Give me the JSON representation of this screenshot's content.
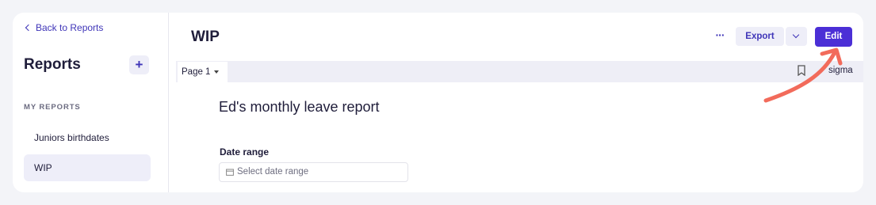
{
  "sidebar": {
    "back_link": "Back to Reports",
    "title": "Reports",
    "add_label": "+",
    "section_label": "MY REPORTS",
    "items": [
      {
        "label": "Juniors birthdates"
      },
      {
        "label": "WIP"
      }
    ]
  },
  "header": {
    "title": "WIP",
    "more_label": "···",
    "export_label": "Export",
    "edit_label": "Edit"
  },
  "pagebar": {
    "page_tab": "Page 1",
    "sigma_label": "sigma"
  },
  "content": {
    "report_title": "Ed's monthly leave report",
    "date_range_label": "Date range",
    "date_range_placeholder": "Select date range"
  },
  "colors": {
    "accent": "#4b2fd6",
    "link": "#3f35b8",
    "annotation_arrow": "#f26b5b",
    "background": "#f3f4f8"
  },
  "icons": [
    "chevron-left-icon",
    "plus-icon",
    "more-icon",
    "chevron-down-icon",
    "bookmark-icon",
    "calendar-icon",
    "annotation-arrow"
  ]
}
